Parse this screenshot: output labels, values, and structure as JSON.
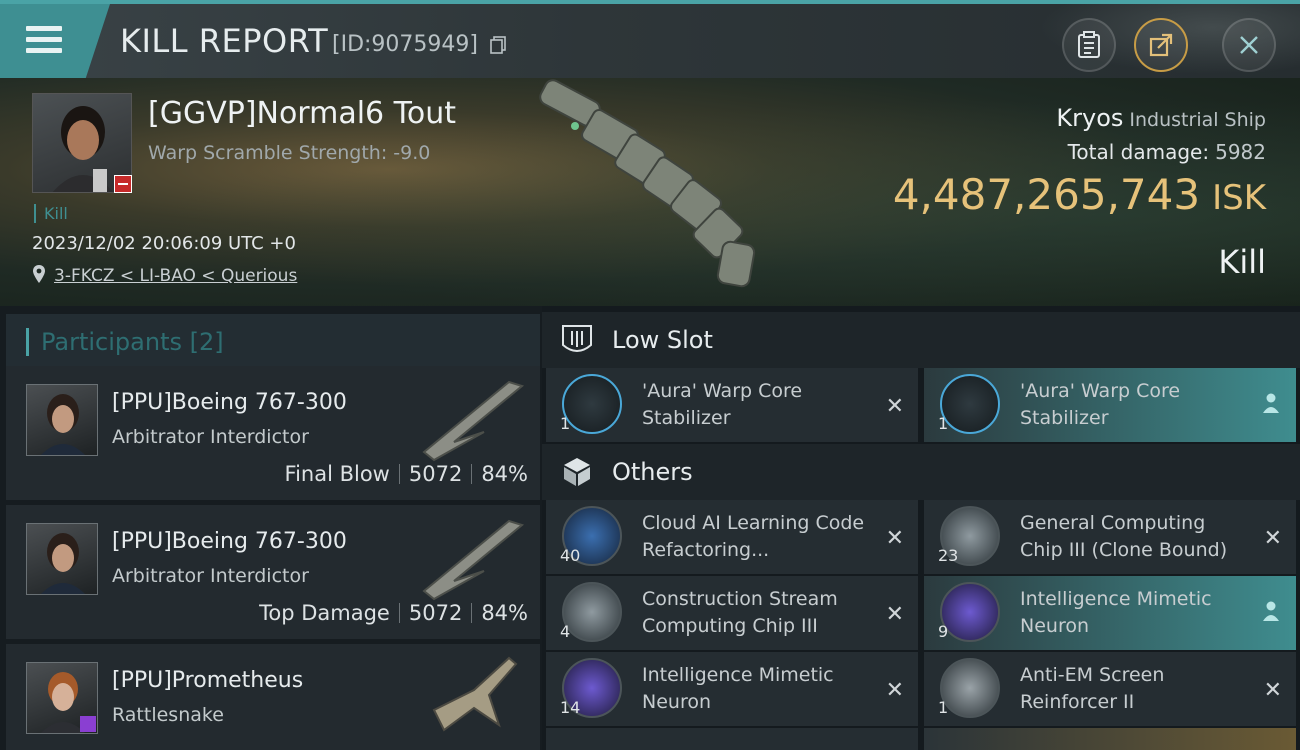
{
  "header": {
    "title": "KILL REPORT",
    "id_text": "[ID:9075949]"
  },
  "victim": {
    "name": "[GGVP]Normal6 Tout",
    "warp_label": "Warp Scramble Strength: -9.0",
    "kill_tag": "Kill",
    "timestamp": "2023/12/02 20:06:09 UTC +0",
    "location": "3-FKCZ < LI-BAO < Querious",
    "ship_name": "Kryos",
    "ship_class": "Industrial Ship",
    "total_damage_label": "Total damage:",
    "total_damage": "5982",
    "isk_value": "4,487,265,743",
    "isk_unit": "ISK",
    "outcome": "Kill"
  },
  "participants": {
    "header": "Participants [2]",
    "rows": [
      {
        "name": "[PPU]Boeing 767-300",
        "ship": "Arbitrator Interdictor",
        "role": "Final Blow",
        "damage": "5072",
        "percent": "84%"
      },
      {
        "name": "[PPU]Boeing 767-300",
        "ship": "Arbitrator Interdictor",
        "role": "Top Damage",
        "damage": "5072",
        "percent": "84%"
      },
      {
        "name": "[PPU]Prometheus",
        "ship": "Rattlesnake"
      }
    ]
  },
  "sections": {
    "low_slot": "Low Slot",
    "others": "Others"
  },
  "items": {
    "low_slot": [
      {
        "name": "'Aura' Warp Core Stabilizer",
        "qty": "1"
      },
      {
        "name": "'Aura' Warp Core Stabilizer",
        "qty": "1"
      }
    ],
    "others": [
      {
        "name": "Cloud AI Learning Code Refactoring...",
        "qty": "40"
      },
      {
        "name": "General Computing Chip III (Clone Bound)",
        "qty": "23"
      },
      {
        "name": "Construction Stream Computing Chip III",
        "qty": "4"
      },
      {
        "name": "Intelligence Mimetic Neuron",
        "qty": "9"
      },
      {
        "name": "Intelligence Mimetic Neuron",
        "qty": "14"
      },
      {
        "name": "Anti-EM Screen Reinforcer II",
        "qty": "1"
      }
    ]
  },
  "colors": {
    "accent": "#4aa3a6",
    "isk": "#e6c27a",
    "selected_item": "#3f8d8f"
  }
}
